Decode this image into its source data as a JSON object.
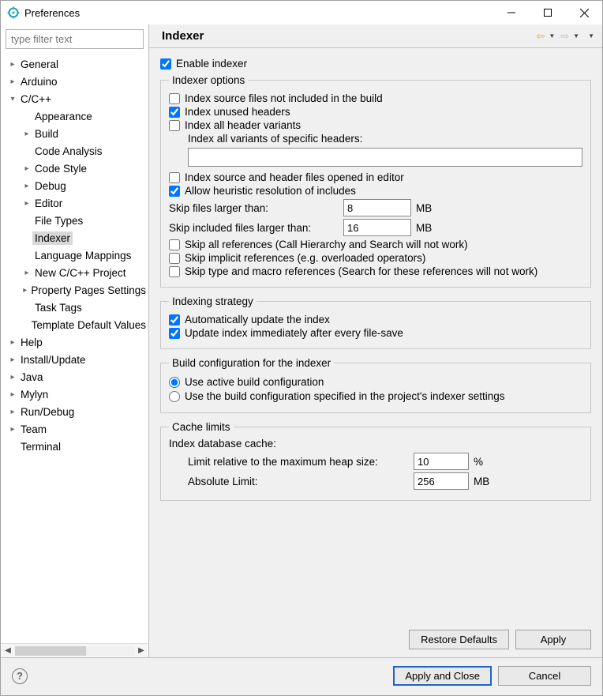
{
  "window": {
    "title": "Preferences"
  },
  "filter": {
    "placeholder": "type filter text"
  },
  "tree": [
    {
      "label": "General",
      "depth": 0,
      "expand": ">",
      "selected": false
    },
    {
      "label": "Arduino",
      "depth": 0,
      "expand": ">",
      "selected": false
    },
    {
      "label": "C/C++",
      "depth": 0,
      "expand": "v",
      "selected": false
    },
    {
      "label": "Appearance",
      "depth": 1,
      "expand": "",
      "selected": false
    },
    {
      "label": "Build",
      "depth": 1,
      "expand": ">",
      "selected": false
    },
    {
      "label": "Code Analysis",
      "depth": 1,
      "expand": "",
      "selected": false
    },
    {
      "label": "Code Style",
      "depth": 1,
      "expand": ">",
      "selected": false
    },
    {
      "label": "Debug",
      "depth": 1,
      "expand": ">",
      "selected": false
    },
    {
      "label": "Editor",
      "depth": 1,
      "expand": ">",
      "selected": false
    },
    {
      "label": "File Types",
      "depth": 1,
      "expand": "",
      "selected": false
    },
    {
      "label": "Indexer",
      "depth": 1,
      "expand": "",
      "selected": true
    },
    {
      "label": "Language Mappings",
      "depth": 1,
      "expand": "",
      "selected": false
    },
    {
      "label": "New C/C++ Project",
      "depth": 1,
      "expand": ">",
      "selected": false
    },
    {
      "label": "Property Pages Settings",
      "depth": 1,
      "expand": ">",
      "selected": false
    },
    {
      "label": "Task Tags",
      "depth": 1,
      "expand": "",
      "selected": false
    },
    {
      "label": "Template Default Values",
      "depth": 1,
      "expand": "",
      "selected": false
    },
    {
      "label": "Help",
      "depth": 0,
      "expand": ">",
      "selected": false
    },
    {
      "label": "Install/Update",
      "depth": 0,
      "expand": ">",
      "selected": false
    },
    {
      "label": "Java",
      "depth": 0,
      "expand": ">",
      "selected": false
    },
    {
      "label": "Mylyn",
      "depth": 0,
      "expand": ">",
      "selected": false
    },
    {
      "label": "Run/Debug",
      "depth": 0,
      "expand": ">",
      "selected": false
    },
    {
      "label": "Team",
      "depth": 0,
      "expand": ">",
      "selected": false
    },
    {
      "label": "Terminal",
      "depth": 0,
      "expand": "",
      "selected": false
    }
  ],
  "page": {
    "title": "Indexer",
    "enable_indexer": "Enable indexer",
    "indexer_options": {
      "legend": "Indexer options",
      "index_source_not_in_build": "Index source files not included in the build",
      "index_unused_headers": "Index unused headers",
      "index_all_header_variants": "Index all header variants",
      "index_all_variants_specific": "Index all variants of specific headers:",
      "specific_headers_value": "",
      "index_opened": "Index source and header files opened in editor",
      "allow_heuristic": "Allow heuristic resolution of includes",
      "skip_files_larger": "Skip files larger than:",
      "skip_files_value": "8",
      "skip_files_unit": "MB",
      "skip_included_larger": "Skip included files larger than:",
      "skip_included_value": "16",
      "skip_included_unit": "MB",
      "skip_all_refs": "Skip all references (Call Hierarchy and Search will not work)",
      "skip_implicit_refs": "Skip implicit references (e.g. overloaded operators)",
      "skip_type_macro_refs": "Skip type and macro references (Search for these references will not work)"
    },
    "indexing_strategy": {
      "legend": "Indexing strategy",
      "auto_update": "Automatically update the index",
      "update_after_save": "Update index immediately after every file-save"
    },
    "build_config": {
      "legend": "Build configuration for the indexer",
      "use_active": "Use active build configuration",
      "use_project": "Use the build configuration specified in the project's indexer settings"
    },
    "cache": {
      "legend": "Cache limits",
      "db_cache_label": "Index database cache:",
      "rel_label": "Limit relative to the maximum heap size:",
      "rel_value": "10",
      "rel_unit": "%",
      "abs_label": "Absolute Limit:",
      "abs_value": "256",
      "abs_unit": "MB"
    }
  },
  "buttons": {
    "restore": "Restore Defaults",
    "apply": "Apply",
    "apply_close": "Apply and Close",
    "cancel": "Cancel"
  }
}
